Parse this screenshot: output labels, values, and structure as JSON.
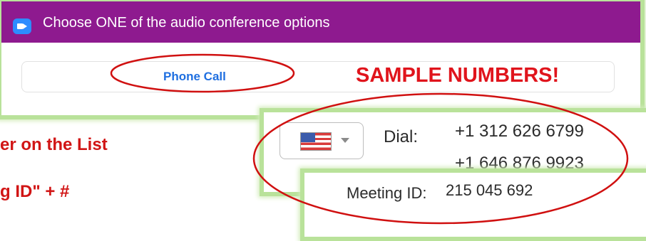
{
  "window": {
    "title": "Choose ONE of the audio conference options",
    "tab_phone": "Phone Call"
  },
  "annotation": {
    "sample_numbers": "SAMPLE NUMBERS!",
    "color": "#e0141c"
  },
  "dial": {
    "label": "Dial:",
    "numbers": [
      "+1 312 626 6799",
      "+1 646 876 9923"
    ],
    "country_flag": "us-flag-icon"
  },
  "meeting": {
    "label": "Meeting ID:",
    "value": "215 045 692"
  },
  "background_text": {
    "line1": "er on the List",
    "line2": "g ID\" + #"
  },
  "colors": {
    "titlebar": "#8e1a8f",
    "panel_border": "#b9e29a",
    "link_blue": "#1f6fe0",
    "zoom_blue": "#2d8cff"
  }
}
